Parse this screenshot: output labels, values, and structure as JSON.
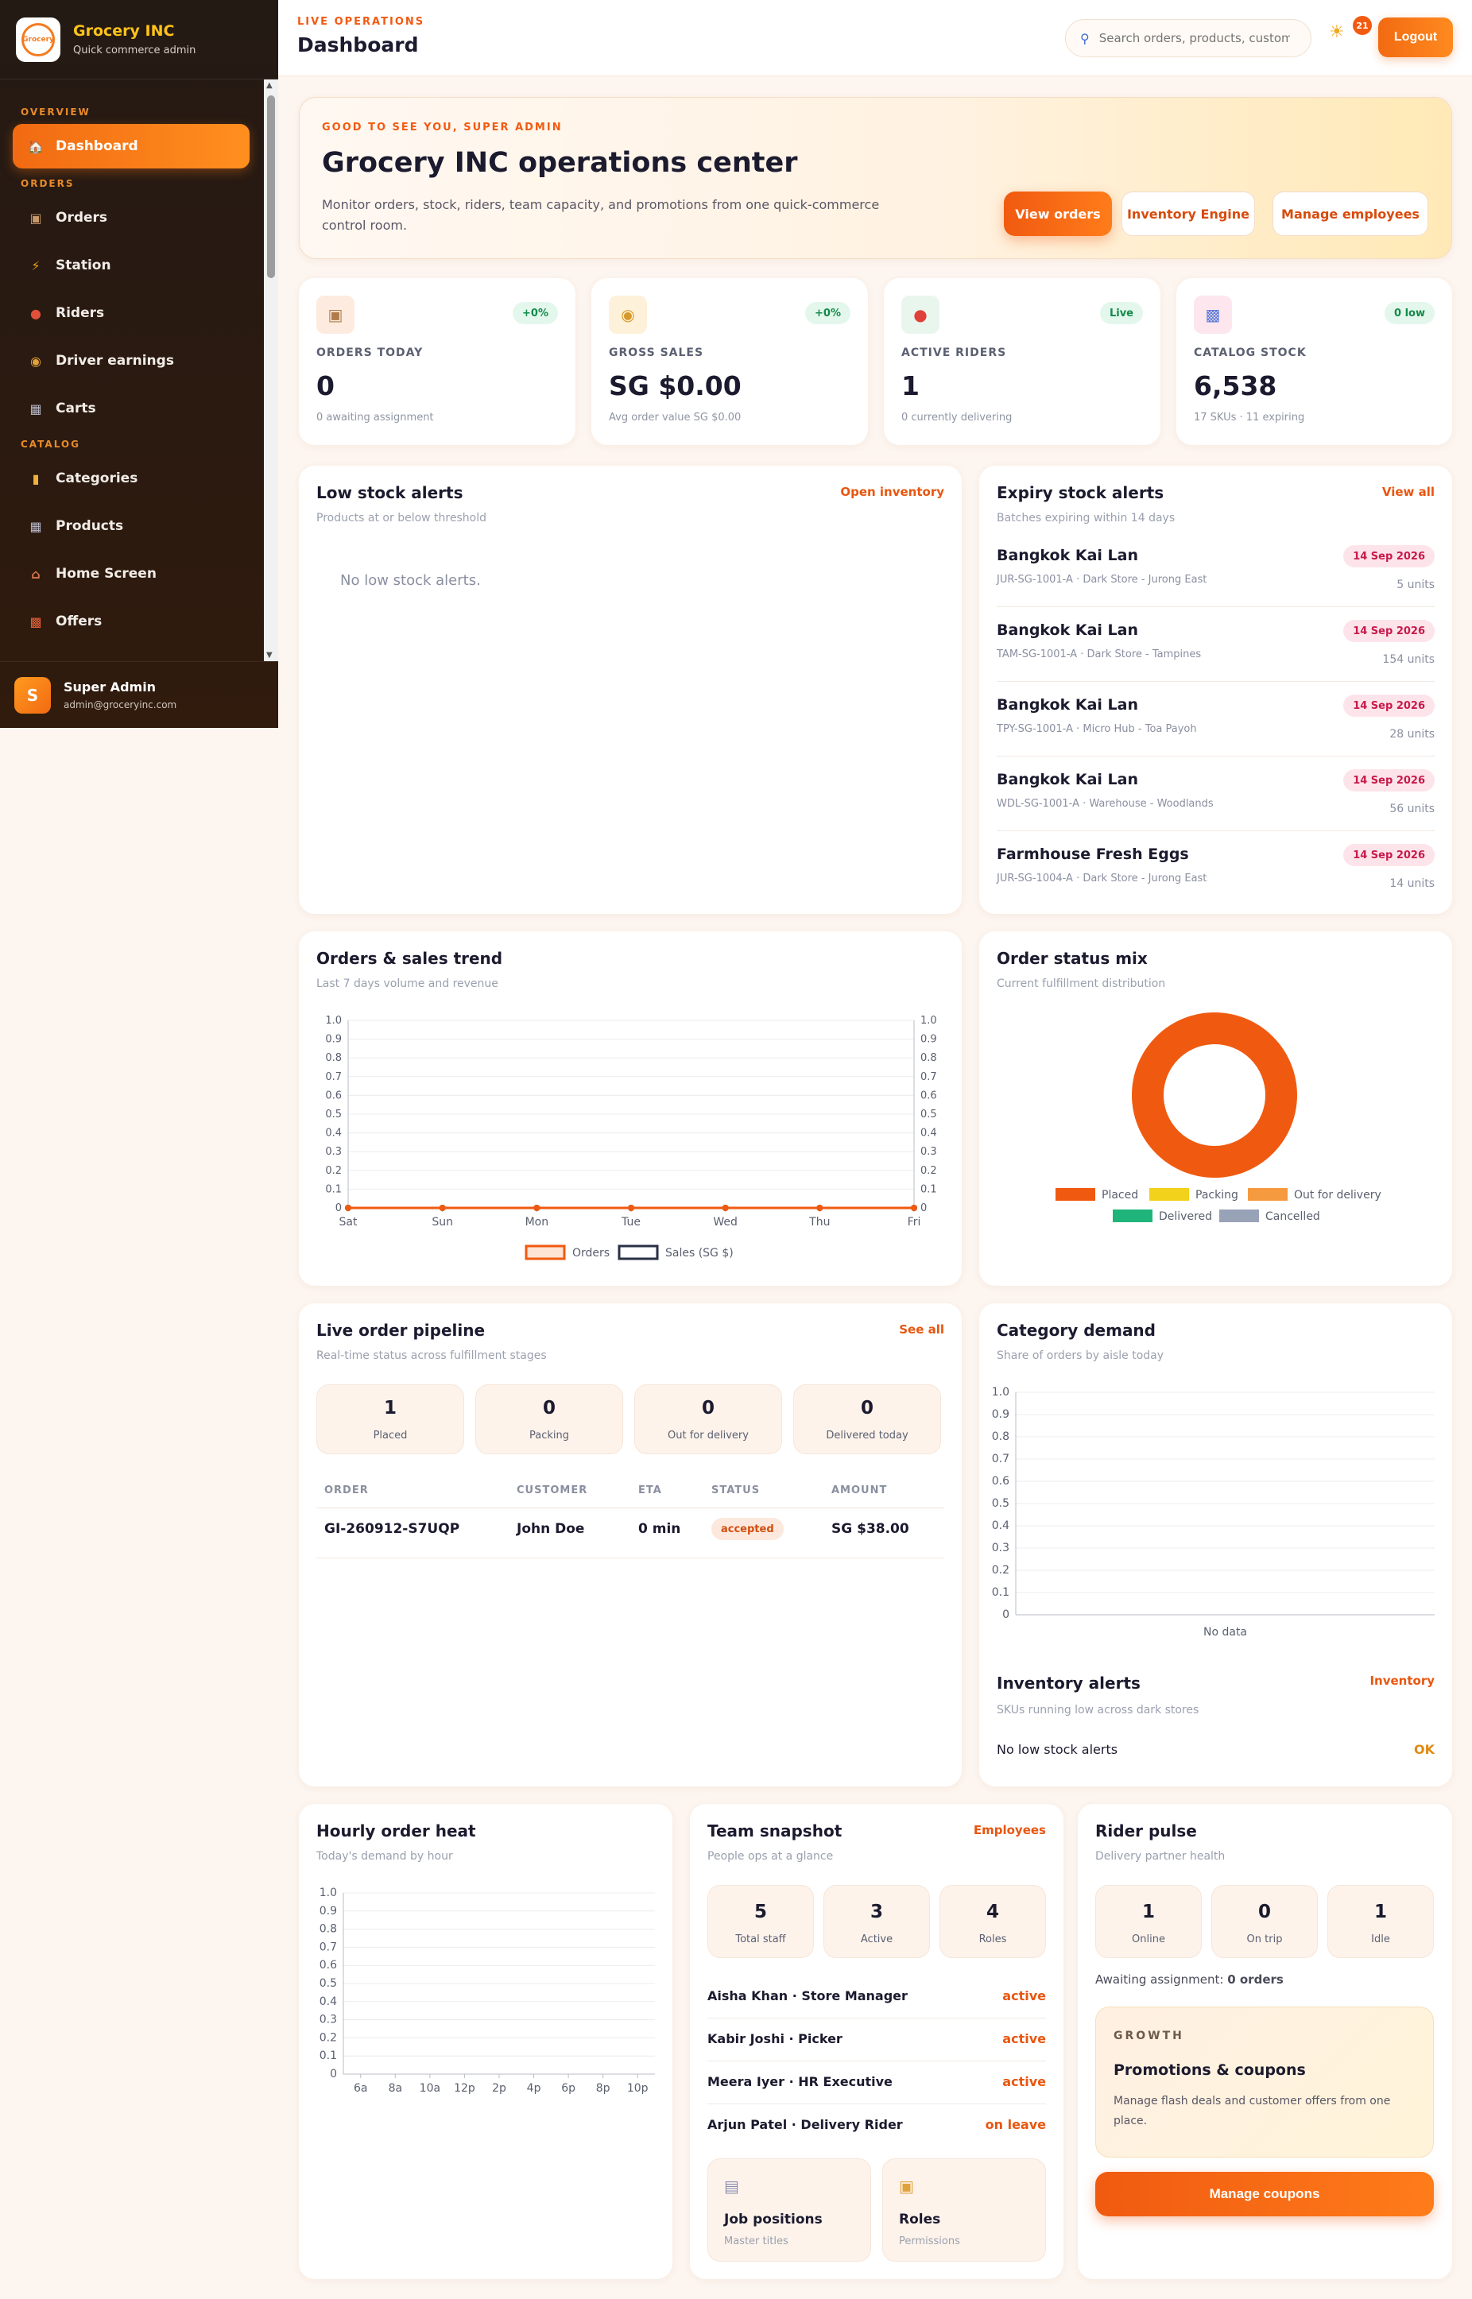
{
  "app": {
    "name": "Grocery INC",
    "subtitle": "Quick commerce admin",
    "logo_text": "Grocery"
  },
  "sidebar": {
    "sections": [
      {
        "label": "OVERVIEW",
        "items": [
          {
            "label": "Dashboard",
            "icon": "home-icon",
            "active": true
          }
        ]
      },
      {
        "label": "ORDERS",
        "items": [
          {
            "label": "Orders",
            "icon": "package-icon"
          },
          {
            "label": "Station",
            "icon": "bolt-icon"
          },
          {
            "label": "Riders",
            "icon": "rider-icon"
          },
          {
            "label": "Driver earnings",
            "icon": "money-bag-icon"
          },
          {
            "label": "Carts",
            "icon": "cart-icon"
          }
        ]
      },
      {
        "label": "CATALOG",
        "items": [
          {
            "label": "Categories",
            "icon": "folder-icon"
          },
          {
            "label": "Products",
            "icon": "cart-icon"
          },
          {
            "label": "Home Screen",
            "icon": "house-icon"
          },
          {
            "label": "Offers",
            "icon": "gift-icon"
          }
        ]
      }
    ],
    "user": {
      "initial": "S",
      "name": "Super Admin",
      "email": "admin@groceryinc.com"
    }
  },
  "topbar": {
    "eyebrow": "LIVE OPERATIONS",
    "title": "Dashboard",
    "search_placeholder": "Search orders, products, customers",
    "notifications": "21",
    "logout": "Logout"
  },
  "hero": {
    "eyebrow": "GOOD TO SEE YOU, SUPER ADMIN",
    "title": "Grocery INC operations center",
    "description": "Monitor orders, stock, riders, team capacity, and promotions from one quick-commerce control room.",
    "buttons": [
      "View orders",
      "Inventory Engine",
      "Manage employees"
    ]
  },
  "stats": [
    {
      "label": "ORDERS TODAY",
      "value": "0",
      "sub": "0 awaiting assignment",
      "badge": "+0%",
      "icon": "box-icon"
    },
    {
      "label": "GROSS SALES",
      "value": "SG $0.00",
      "sub": "Avg order value SG $0.00",
      "badge": "+0%",
      "icon": "money-bag-icon"
    },
    {
      "label": "ACTIVE RIDERS",
      "value": "1",
      "sub": "0 currently delivering",
      "badge": "Live",
      "icon": "scooter-icon"
    },
    {
      "label": "CATALOG STOCK",
      "value": "6,538",
      "sub": "17 SKUs · 11 expiring",
      "badge": "0 low",
      "icon": "bar-chart-icon"
    }
  ],
  "low_stock": {
    "title": "Low stock alerts",
    "subtitle": "Products at or below threshold",
    "link": "Open inventory",
    "empty": "No low stock alerts."
  },
  "expiry": {
    "title": "Expiry stock alerts",
    "subtitle": "Batches expiring within 14 days",
    "link": "View all",
    "items": [
      {
        "name": "Bangkok Kai Lan",
        "meta": "JUR-SG-1001-A · Dark Store - Jurong East",
        "date": "14 Sep 2026",
        "units": "5 units"
      },
      {
        "name": "Bangkok Kai Lan",
        "meta": "TAM-SG-1001-A · Dark Store - Tampines",
        "date": "14 Sep 2026",
        "units": "154 units"
      },
      {
        "name": "Bangkok Kai Lan",
        "meta": "TPY-SG-1001-A · Micro Hub - Toa Payoh",
        "date": "14 Sep 2026",
        "units": "28 units"
      },
      {
        "name": "Bangkok Kai Lan",
        "meta": "WDL-SG-1001-A · Warehouse - Woodlands",
        "date": "14 Sep 2026",
        "units": "56 units"
      },
      {
        "name": "Farmhouse Fresh Eggs",
        "meta": "JUR-SG-1004-A · Dark Store - Jurong East",
        "date": "14 Sep 2026",
        "units": "14 units"
      }
    ]
  },
  "trend": {
    "title": "Orders & sales trend",
    "subtitle": "Last 7 days volume and revenue"
  },
  "status_mix": {
    "title": "Order status mix",
    "subtitle": "Current fulfillment distribution"
  },
  "pipeline": {
    "title": "Live order pipeline",
    "subtitle": "Real-time status across fulfillment stages",
    "link": "See all",
    "stages": [
      {
        "value": "1",
        "label": "Placed"
      },
      {
        "value": "0",
        "label": "Packing"
      },
      {
        "value": "0",
        "label": "Out for delivery"
      },
      {
        "value": "0",
        "label": "Delivered today"
      }
    ],
    "columns": [
      "ORDER",
      "CUSTOMER",
      "ETA",
      "STATUS",
      "AMOUNT"
    ],
    "rows": [
      {
        "order": "GI-260912-S7UQP",
        "customer": "John Doe",
        "eta": "0 min",
        "status": "accepted",
        "amount": "SG $38.00"
      }
    ]
  },
  "category": {
    "title": "Category demand",
    "subtitle": "Share of orders by aisle today"
  },
  "inventory_alerts": {
    "title": "Inventory alerts",
    "subtitle": "SKUs running low across dark stores",
    "link": "Inventory",
    "text": "No low stock alerts",
    "status": "OK"
  },
  "hourly": {
    "title": "Hourly order heat",
    "subtitle": "Today's demand by hour"
  },
  "team": {
    "title": "Team snapshot",
    "subtitle": "People ops at a glance",
    "link": "Employees",
    "stats": [
      {
        "value": "5",
        "label": "Total staff"
      },
      {
        "value": "3",
        "label": "Active"
      },
      {
        "value": "4",
        "label": "Roles"
      }
    ],
    "members": [
      {
        "name": "Aisha Khan · Store Manager",
        "status": "active"
      },
      {
        "name": "Kabir Joshi · Picker",
        "status": "active"
      },
      {
        "name": "Meera Iyer · HR Executive",
        "status": "active"
      },
      {
        "name": "Arjun Patel · Delivery Rider",
        "status": "on leave"
      }
    ],
    "tiles": [
      {
        "title": "Job positions",
        "sub": "Master titles",
        "icon": "clipboard-icon"
      },
      {
        "title": "Roles",
        "sub": "Permissions",
        "icon": "lock-icon"
      }
    ]
  },
  "rider": {
    "title": "Rider pulse",
    "subtitle": "Delivery partner health",
    "stats": [
      {
        "value": "1",
        "label": "Online"
      },
      {
        "value": "0",
        "label": "On trip"
      },
      {
        "value": "1",
        "label": "Idle"
      }
    ],
    "awaiting_label": "Awaiting assignment:",
    "awaiting_value": "0 orders",
    "growth": {
      "eyebrow": "GROWTH",
      "title": "Promotions & coupons",
      "desc": "Manage flash deals and customer offers from one place."
    },
    "button": "Manage coupons"
  },
  "chart_data": [
    {
      "type": "line",
      "categories": [
        "Sat",
        "Sun",
        "Mon",
        "Tue",
        "Wed",
        "Thu",
        "Fri"
      ],
      "series": [
        {
          "name": "Orders",
          "values": [
            0,
            0,
            0,
            0,
            0,
            0,
            0
          ],
          "color": "#f05a10"
        },
        {
          "name": "Sales (SG $)",
          "values": [
            0,
            0,
            0,
            0,
            0,
            0,
            0
          ],
          "color": "#2a2f45"
        }
      ],
      "ylim": [
        0,
        1
      ],
      "y2lim": [
        0,
        1
      ],
      "yticks": [
        "0",
        "0.1",
        "0.2",
        "0.3",
        "0.4",
        "0.5",
        "0.6",
        "0.7",
        "0.8",
        "0.9",
        "1.0"
      ],
      "grid": true,
      "legend": "bottom"
    },
    {
      "type": "pie",
      "labels": [
        "Placed",
        "Packing",
        "Out for delivery",
        "Delivered",
        "Cancelled"
      ],
      "values": [
        1,
        0,
        0,
        0,
        0
      ],
      "colors": [
        "#f05a10",
        "#f2d21a",
        "#f59a3e",
        "#1fb57a",
        "#99a3b8"
      ],
      "legend": "bottom"
    },
    {
      "type": "bar",
      "categories": [],
      "values": [],
      "ylim": [
        0,
        1
      ],
      "yticks": [
        "0",
        "0.1",
        "0.2",
        "0.3",
        "0.4",
        "0.5",
        "0.6",
        "0.7",
        "0.8",
        "0.9",
        "1.0"
      ],
      "xlabel": "No data",
      "grid": true
    },
    {
      "type": "bar",
      "categories": [
        "6a",
        "8a",
        "10a",
        "12p",
        "2p",
        "4p",
        "6p",
        "8p",
        "10p"
      ],
      "values": [
        0,
        0,
        0,
        0,
        0,
        0,
        0,
        0,
        0
      ],
      "ylim": [
        0,
        1
      ],
      "yticks": [
        "0",
        "0.1",
        "0.2",
        "0.3",
        "0.4",
        "0.5",
        "0.6",
        "0.7",
        "0.8",
        "0.9",
        "1.0"
      ],
      "grid": true
    }
  ],
  "colors": {
    "accent": "#f05a10",
    "brand_yellow": "#ffc21a",
    "success": "#138a4a",
    "danger": "#c81a4a"
  }
}
